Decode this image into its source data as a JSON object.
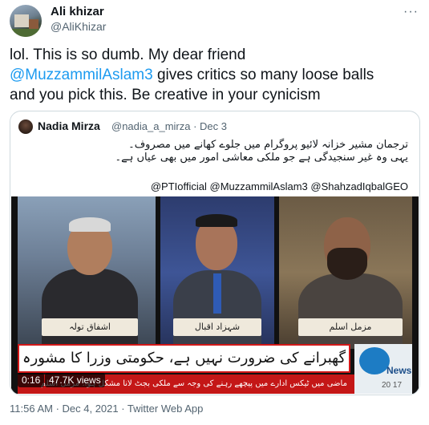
{
  "author": {
    "display_name": "Ali khizar",
    "handle": "@AliKhizar",
    "avatar_icon": "profile-photo"
  },
  "more_icon": "···",
  "tweet": {
    "line1": "lol. This is so dumb. My dear friend",
    "mention": "@MuzzammilAslam3",
    "line2_rest": " gives critics so many loose balls",
    "line3": "and you pick this. Be creative in your cynicism"
  },
  "quote": {
    "name": "Nadia Mirza",
    "handle_date": "@nadia_a_mirza · Dec 3",
    "urdu_line1": "ترجمان مشیر خزانہ لائیو پروگرام میں جلوے کھانے میں مصروف۔",
    "urdu_line2": "یہی وہ غیر سنجیدگی ہے جو ملکی معاشی امور میں بھی عیاں ہے۔",
    "mentions": "@PTIofficial @MuzzammilAslam3 @ShahzadIqbalGEO"
  },
  "video": {
    "speaker1": "اشفاق تولہ",
    "speaker2": "شہزاد اقبال",
    "speaker3": "مزمل اسلم",
    "ticker_main": "گھبرانے کی ضرورت نہیں ہے، حکومتی وزرا کا مشورہ",
    "ticker_sub": "ماضی میں ٹیکس ادارے میں پیچھے رہنے کی وجہ سے ملکی بجٹ لانا مشکل ہوا: مزمل اسلم",
    "channel_news": "News",
    "channel_time": "20 17",
    "duration": "0:16",
    "views": "47.7K views"
  },
  "footer": "11:56 AM · Dec 4, 2021 · Twitter Web App"
}
